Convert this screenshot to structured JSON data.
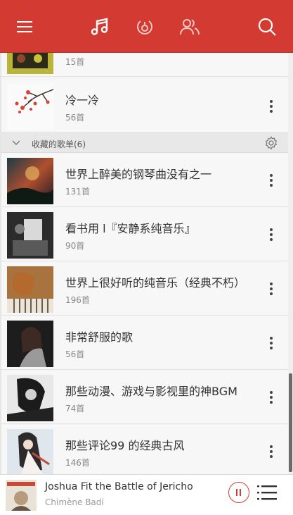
{
  "header": {
    "icons": [
      "menu-icon",
      "music-note-icon",
      "radio-icon",
      "friends-icon",
      "search-icon"
    ],
    "accent": "#d33a31"
  },
  "top_rows": [
    {
      "title": "",
      "count": "15首"
    },
    {
      "title": "冷一冷",
      "count": "56首"
    }
  ],
  "section": {
    "label": "收藏的歌单(6)"
  },
  "playlists": [
    {
      "title": "世界上醉美的钢琴曲没有之一",
      "count": "131首"
    },
    {
      "title": "看书用 l『安静系纯音乐』",
      "count": "90首"
    },
    {
      "title": "世界上很好听的纯音乐（经典不朽）",
      "count": "196首"
    },
    {
      "title": "非常舒服的歌",
      "count": "56首"
    },
    {
      "title": "那些动漫、游戏与影视里的神BGM",
      "count": "74首"
    },
    {
      "title": "那些评论99 的经典古风",
      "count": "146首"
    }
  ],
  "player": {
    "title": "Joshua Fit the Battle of Jericho",
    "artist": "Chimène Badi"
  }
}
